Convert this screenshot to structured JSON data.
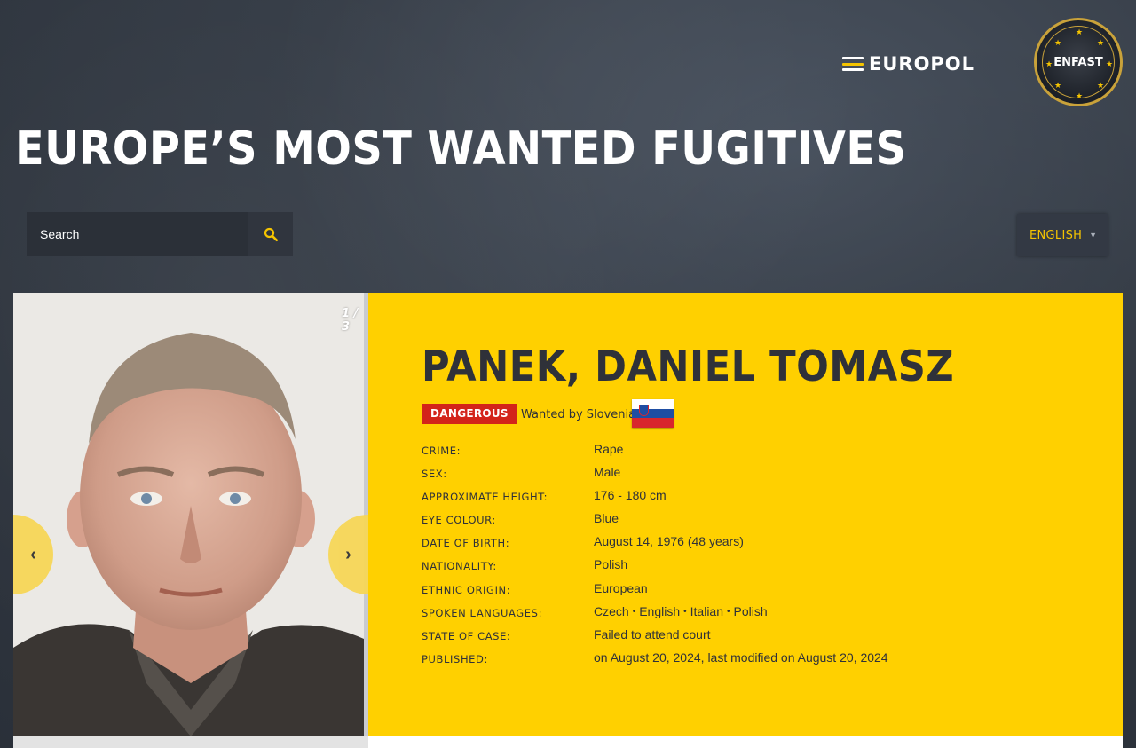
{
  "header": {
    "europol_text": "EUROPOL",
    "enfast_text": "ENFAST",
    "title": "EUROPE’S MOST WANTED FUGITIVES"
  },
  "search": {
    "placeholder": "Search",
    "icon": "search-icon"
  },
  "language": {
    "selected": "ENGLISH"
  },
  "gallery": {
    "counter": "1 / 3",
    "prev_label": "‹",
    "next_label": "›"
  },
  "fugitive": {
    "name": "PANEK, DANIEL TOMASZ",
    "badge": "DANGEROUS",
    "wanted_by": "Wanted by Slovenia",
    "flag": "Slovenia",
    "details": [
      {
        "label": "CRIME:",
        "value": "Rape"
      },
      {
        "label": "SEX:",
        "value": "Male"
      },
      {
        "label": "APPROXIMATE HEIGHT:",
        "value": "176 - 180 cm"
      },
      {
        "label": "EYE COLOUR:",
        "value": "Blue"
      },
      {
        "label": "DATE OF BIRTH:",
        "value": "August 14, 1976 (48 years)"
      },
      {
        "label": "NATIONALITY:",
        "value": "Polish"
      },
      {
        "label": "ETHNIC ORIGIN:",
        "value": "European"
      },
      {
        "label": "SPOKEN LANGUAGES:",
        "languages": [
          "Czech",
          "English",
          "Italian",
          "Polish"
        ]
      },
      {
        "label": "STATE OF CASE:",
        "value": "Failed to attend court"
      },
      {
        "label": "PUBLISHED:",
        "value": "on August 20, 2024, last modified on August 20, 2024"
      }
    ]
  },
  "colors": {
    "accent_yellow": "#ffd000",
    "danger_red": "#d3241a",
    "text_dark": "#2f3139"
  }
}
